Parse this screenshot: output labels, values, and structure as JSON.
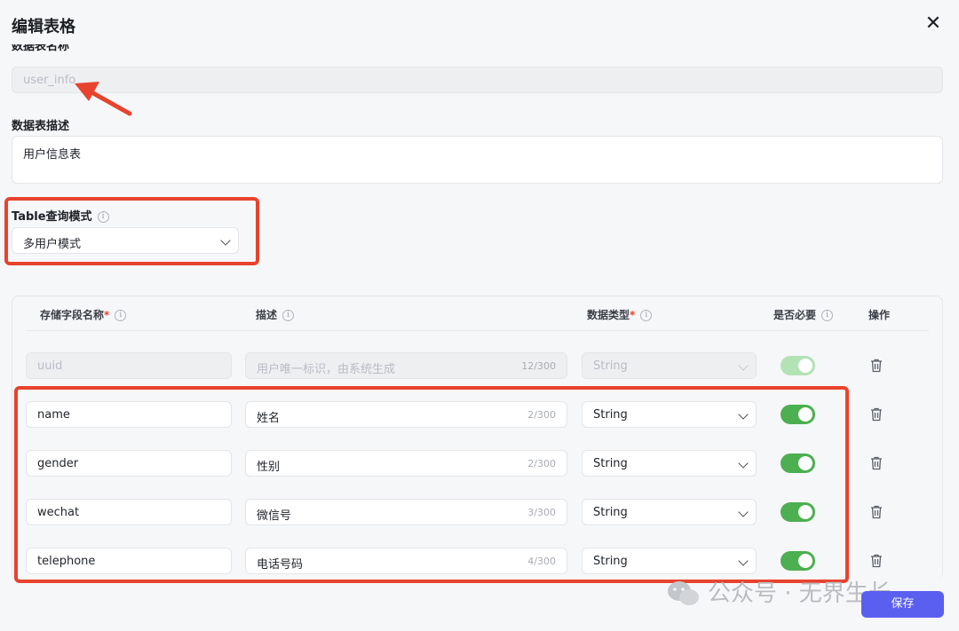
{
  "dialog": {
    "title": "编辑表格",
    "close_glyph": "✕"
  },
  "table_name": {
    "label": "数据表名称",
    "value": "user_info"
  },
  "table_desc": {
    "label": "数据表描述",
    "value": "用户信息表"
  },
  "query_mode": {
    "label": "Table查询模式",
    "value": "多用户模式"
  },
  "fields_table": {
    "headers": {
      "name": "存储字段名称",
      "desc": "描述",
      "type": "数据类型",
      "required": "是否必要",
      "actions": "操作"
    },
    "rows": [
      {
        "name": "uuid",
        "desc": "用户唯一标识，由系统生成",
        "count": "12/300",
        "type": "String",
        "required": true,
        "disabled": true
      },
      {
        "name": "name",
        "desc": "姓名",
        "count": "2/300",
        "type": "String",
        "required": true,
        "disabled": false
      },
      {
        "name": "gender",
        "desc": "性别",
        "count": "2/300",
        "type": "String",
        "required": true,
        "disabled": false
      },
      {
        "name": "wechat",
        "desc": "微信号",
        "count": "3/300",
        "type": "String",
        "required": true,
        "disabled": false
      },
      {
        "name": "telephone",
        "desc": "电话号码",
        "count": "4/300",
        "type": "String",
        "required": true,
        "disabled": false
      }
    ]
  },
  "watermark": "公众号 · 无界生长",
  "save_label": "保存",
  "colors": {
    "accent": "#5b5ff0",
    "toggle_on": "#4caf50",
    "annotation_red": "#e8432e"
  }
}
